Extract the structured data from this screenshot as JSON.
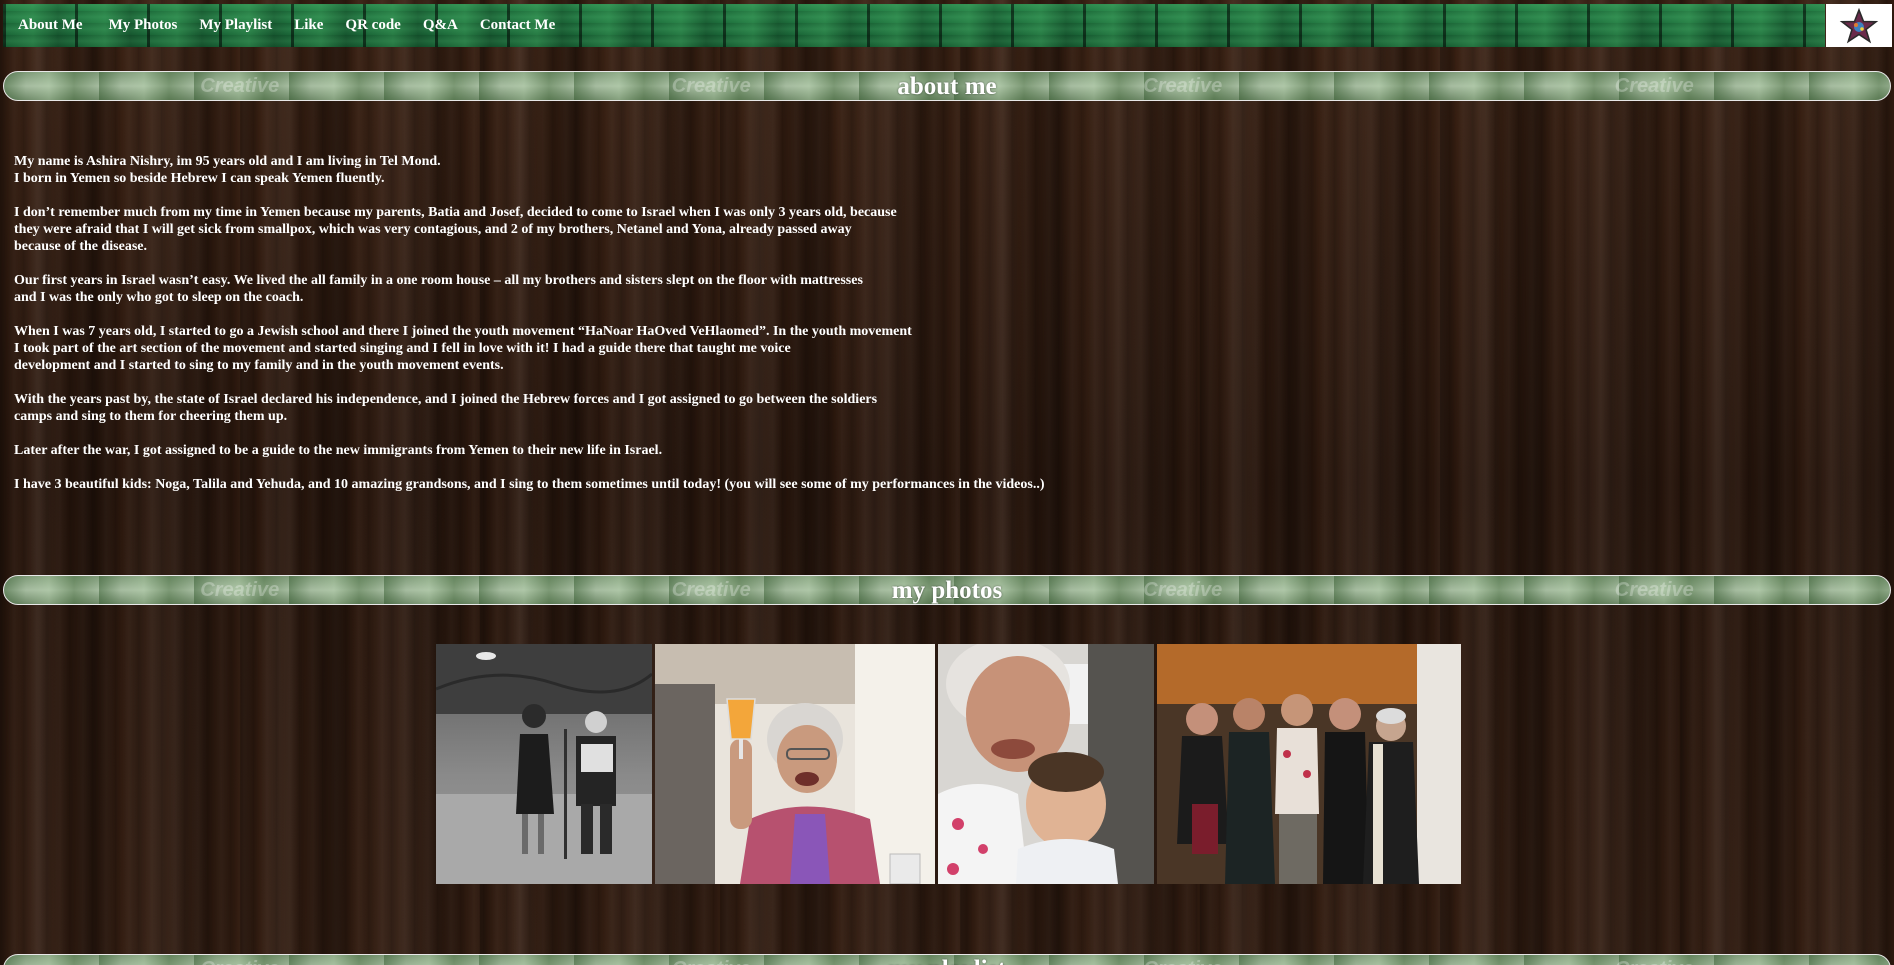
{
  "nav": {
    "items": [
      {
        "label": "About Me"
      },
      {
        "label": "My Photos"
      },
      {
        "label": "My Playlist"
      },
      {
        "label": "Like"
      },
      {
        "label": "QR code"
      },
      {
        "label": "Q&A"
      },
      {
        "label": "Contact Me"
      }
    ],
    "logo_icon": "star-logo-icon"
  },
  "sections": {
    "about": {
      "title": "about me",
      "paragraphs": [
        "My name is Ashira Nishry, im 95 years old and I am living in Tel Mond.\nI born in Yemen so beside Hebrew I can speak Yemen fluently.",
        "I don’t remember much from my time in Yemen because my parents, Batia and Josef, decided to come to Israel when I was only 3 years old, because\nthey were afraid that I will get sick from smallpox, which was very contagious, and 2 of my brothers, Netanel and Yona, already passed away\nbecause of the disease.",
        "Our first years in Israel wasn’t easy. We lived the all family in a one room house – all my brothers and sisters slept on the floor with mattresses\nand I was the only who got to sleep on the coach.",
        "When I was 7 years old, I started to go a Jewish school and there I joined the youth movement “HaNoar HaOved VeHlaomed”. In the youth movement\nI took part of the art section of the movement and started singing and I fell in love with it! I had a guide there that taught me voice\ndevelopment and I started to sing to my family and in the youth movement events.",
        "With the years past by, the state of Israel declared his independence, and I joined the Hebrew forces and I got assigned to go between the soldiers\ncamps and sing to them for cheering them up.",
        "Later after the war, I got assigned to be a guide to the new immigrants from Yemen to their new life in Israel.",
        "I have 3 beautiful kids: Noga, Talila and Yehuda, and 10 amazing grandsons, and I sing to them sometimes until today! (you will see some of my performances in the videos..)"
      ]
    },
    "photos": {
      "title": "my photos"
    },
    "playlist": {
      "title": "my playlist"
    }
  },
  "banner_watermark": "Creative",
  "colors": {
    "nav_green": "#1d6a3a",
    "banner_green": "#8fa78a",
    "wood_brown": "#2e1a10",
    "text": "#ffffff"
  }
}
